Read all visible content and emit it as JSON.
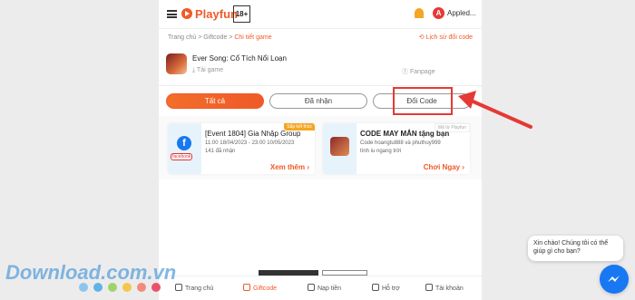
{
  "header": {
    "logo_text": "Playfun",
    "age_rating": "18+",
    "username": "Appled..."
  },
  "breadcrumb": {
    "items": [
      "Trang chủ",
      "Giftcode",
      "Chi tiết game"
    ],
    "separator": ">",
    "history_link": "Lịch sử đổi code"
  },
  "game": {
    "title": "Ever Song: Cổ Tích Nổi Loạn",
    "download_label": "Tải game",
    "fanpage_label": "Fanpage"
  },
  "tabs": [
    {
      "label": "Tất cả",
      "active": true
    },
    {
      "label": "Đã nhận",
      "active": false
    },
    {
      "label": "Đổi Code",
      "active": false
    }
  ],
  "cards": [
    {
      "badge": "Sắp kết thúc",
      "title": "[Event 1804] Gia Nhập Group",
      "time": "11:00 18/04/2023 - 23:00 10/05/2023",
      "received": "141 đã nhận",
      "source_tag": "facebook",
      "action": "Xem thêm"
    },
    {
      "badge": "Mã từ Playfun",
      "title": "CODE MAY MẮN tặng bạn",
      "line1": "Code hoangtu888 và phuthuy999",
      "line2": "tình iu ngang trời",
      "action": "Chơi Ngay"
    }
  ],
  "bottom_nav": [
    {
      "label": "Trang chủ",
      "icon": "home-icon",
      "active": false
    },
    {
      "label": "Giftcode",
      "icon": "gift-icon",
      "active": true
    },
    {
      "label": "Nạp tiền",
      "icon": "wallet-icon",
      "active": false
    },
    {
      "label": "Hỗ trợ",
      "icon": "support-icon",
      "active": false
    },
    {
      "label": "Tài khoản",
      "icon": "user-icon",
      "active": false
    }
  ],
  "chat": {
    "message": "Xin chào! Chúng tôi có thể giúp gì cho bạn?"
  },
  "watermark": {
    "text": "Download.com.vn",
    "dot_colors": [
      "#8ec5ea",
      "#5fb3e6",
      "#9fd36b",
      "#f6c64a",
      "#f28b7a",
      "#e9526c"
    ]
  },
  "colors": {
    "brand": "#f05a28",
    "annotation": "#e53935"
  }
}
